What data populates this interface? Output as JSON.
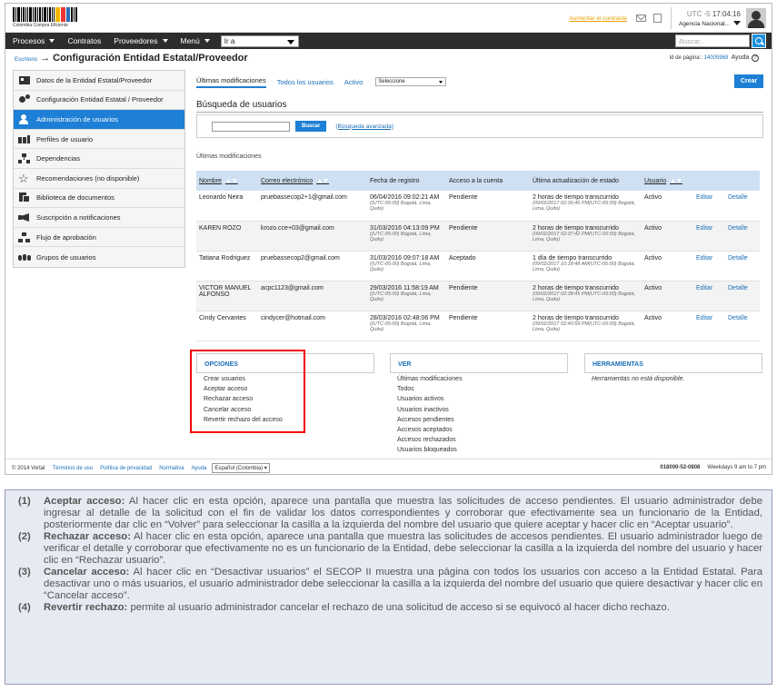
{
  "header": {
    "logo_text": "Colombia Compra Eficiente",
    "contrast_link": "Aumentar el contraste",
    "utc_label": "UTC -5",
    "time": "17:04:16",
    "agency": "Agencia Nacional..."
  },
  "nav": {
    "items": [
      "Procesos",
      "Contratos",
      "Proveedores",
      "Menú"
    ],
    "goto": "Ir a",
    "search_placeholder": "Buscar..."
  },
  "breadcrumb": {
    "home": "Escritorio",
    "arrow": "→",
    "title": "Configuración Entidad Estatal/Proveedor"
  },
  "page_id": {
    "label": "Id de página::",
    "value": "14005969",
    "help": "Ayuda",
    "help_icon": "?"
  },
  "sidebar": {
    "items": [
      {
        "label": "Datos de la Entidad Estatal/Proveedor",
        "icon": "id-card-icon"
      },
      {
        "label": "Configuración Entidad Estatal / Proveedor",
        "icon": "gears-icon"
      },
      {
        "label": "Administración de usuarios",
        "icon": "user-icon"
      },
      {
        "label": "Perfiles de usuario",
        "icon": "users-key-icon"
      },
      {
        "label": "Dependencias",
        "icon": "org-chart-icon"
      },
      {
        "label": "Recomendaciones (no disponible)",
        "icon": "star-icon"
      },
      {
        "label": "Biblioteca de documentos",
        "icon": "documents-icon"
      },
      {
        "label": "Suscripción a notificaciones",
        "icon": "megaphone-icon"
      },
      {
        "label": "Flujo de aprobación",
        "icon": "flow-icon"
      },
      {
        "label": "Grupos de usuarios",
        "icon": "group-icon"
      }
    ]
  },
  "tabs": [
    "Últimas modificaciones",
    "Todos los usuarios",
    "Activo"
  ],
  "filter_select": "Seleccione",
  "create_button": "Crear",
  "search_section": {
    "title": "Búsqueda de usuarios",
    "button": "Buscar",
    "advanced": "(Búsqueda avanzada)"
  },
  "list_label": "Últimas modificaciones",
  "table": {
    "headers": [
      "Nombre",
      "Correo electrónico",
      "Fecha de registro",
      "Acceso a la cuenta",
      "Última actualización de estado",
      "Usuario"
    ],
    "sort_arrows": "▲▼",
    "edit_label": "Editar",
    "detail_label": "Detalle",
    "rows": [
      {
        "name": "Leonardo Neira",
        "email": "pruebassecop2+1@gmail.com",
        "date": "06/04/2016 09:02:21 AM",
        "date_tz": "((UTC-05:00) Bogotá, Lima, Quito)",
        "access": "Pendiente",
        "update": "2 horas de tiempo transcurrido",
        "update_sub": "(09/02/2017 02:36:46 PM(UTC-05:00) Bogotá, Lima, Quito)",
        "status": "Activo"
      },
      {
        "name": "KAREN ROZO",
        "email": "krozo.cce+03@gmail.com",
        "date": "31/03/2016 04:13:09 PM",
        "date_tz": "((UTC-05:00) Bogotá, Lima, Quito)",
        "access": "Pendiente",
        "update": "2 horas de tiempo transcurrido",
        "update_sub": "(09/02/2017 02:37:42 PM(UTC-05:00) Bogotá, Lima, Quito)",
        "status": "Activo"
      },
      {
        "name": "Tatiana Rodriguez",
        "email": "pruebassecop2@gmail.com",
        "date": "31/03/2016 09:07:18 AM",
        "date_tz": "((UTC-05:00) Bogotá, Lima, Quito)",
        "access": "Aceptado",
        "update": "1 día de tiempo transcurrido",
        "update_sub": "(09/02/2017 10:18:48 AM(UTC-05:00) Bogotá, Lima, Quito)",
        "status": "Activo"
      },
      {
        "name": "VICTOR MANUEL ALFONSO",
        "email": "acpc1123@gmail.com",
        "date": "29/03/2016 11:58:19 AM",
        "date_tz": "((UTC-05:00) Bogotá, Lima, Quito)",
        "access": "Pendiente",
        "update": "2 horas de tiempo transcurrido",
        "update_sub": "(09/02/2017 02:38:45 PM(UTC-05:00) Bogotá, Lima, Quito)",
        "status": "Activo"
      },
      {
        "name": "Cindy Cervantes",
        "email": "cindycer@hotmail.com",
        "date": "28/03/2016 02:48:06 PM",
        "date_tz": "((UTC-05:00) Bogotá, Lima, Quito)",
        "access": "Pendiente",
        "update": "2 horas de tiempo transcurrido",
        "update_sub": "(09/02/2017 02:40:59 PM(UTC-05:00) Bogotá, Lima, Quito)",
        "status": "Activo"
      }
    ]
  },
  "panels": {
    "options": {
      "title": "OPCIONES",
      "items": [
        "Crear usuarios",
        "Aceptar acceso",
        "Rechazar acceso",
        "Cancelar acceso",
        "Revertir rechazo del acceso"
      ]
    },
    "view": {
      "title": "VER",
      "items": [
        "Últimas modificaciones",
        "Todos",
        "Usuarios activos",
        "Usuarios inactivos",
        "Accesos pendientes",
        "Accesos aceptados",
        "Accesos rechazados",
        "Usuarios bloqueados"
      ]
    },
    "tools": {
      "title": "HERRAMIENTAS",
      "note": "Herramientas no está disponible."
    }
  },
  "footer": {
    "copyright": "© 2014 Vortal",
    "links": [
      "Términos de uso",
      "Política de privacidad",
      "Normativa",
      "Ayuda"
    ],
    "language": "Español (Colombia)",
    "phone": "018000-52-0808",
    "hours": "Weekdays 9 am to 7 pm"
  },
  "notes": [
    {
      "num": "(1)",
      "title": "Aceptar acceso:",
      "text": "Al hacer clic en esta opción, aparece una pantalla que muestra las solicitudes de acceso pendientes. El usuario administrador debe ingresar al detalle de la solicitud con el fin de validar los datos correspondientes y corroborar que efectivamente sea un funcionario de la Entidad, posteriormente dar clic en “Volver” para seleccionar la casilla a la izquierda del nombre del usuario que quiere aceptar y hacer clic en “Aceptar usuario”."
    },
    {
      "num": "(2)",
      "title": "Rechazar acceso:",
      "text": "Al hacer clic en esta opción, aparece una pantalla que muestra las solicitudes de accesos pendientes. El usuario administrador luego de verificar el detalle y corroborar que efectivamente no es un funcionario de la Entidad, debe seleccionar la casilla a la izquierda del nombre del usuario y hacer clic en “Rechazar usuario”."
    },
    {
      "num": "(3)",
      "title": "Cancelar acceso:",
      "text": "Al hacer clic en “Desactivar usuarios” el SECOP II muestra una página con todos los usuarios con acceso a la Entidad Estatal. Para desactivar uno o más usuarios, el usuario administrador debe seleccionar la casilla a la izquierda del nombre del usuario que quiere desactivar y hacer clic en “Cancelar acceso”."
    },
    {
      "num": "(4)",
      "title": "Revertir rechazo:",
      "text": "permite al usuario administrador cancelar el rechazo de una solicitud de acceso si se equivocó al hacer dicho rechazo."
    }
  ],
  "colors": {
    "accent": "#1d7fd5",
    "navbar": "#2d2d2d",
    "highlight_box": "#ee0000",
    "notes_bg": "#e6eaf2"
  }
}
